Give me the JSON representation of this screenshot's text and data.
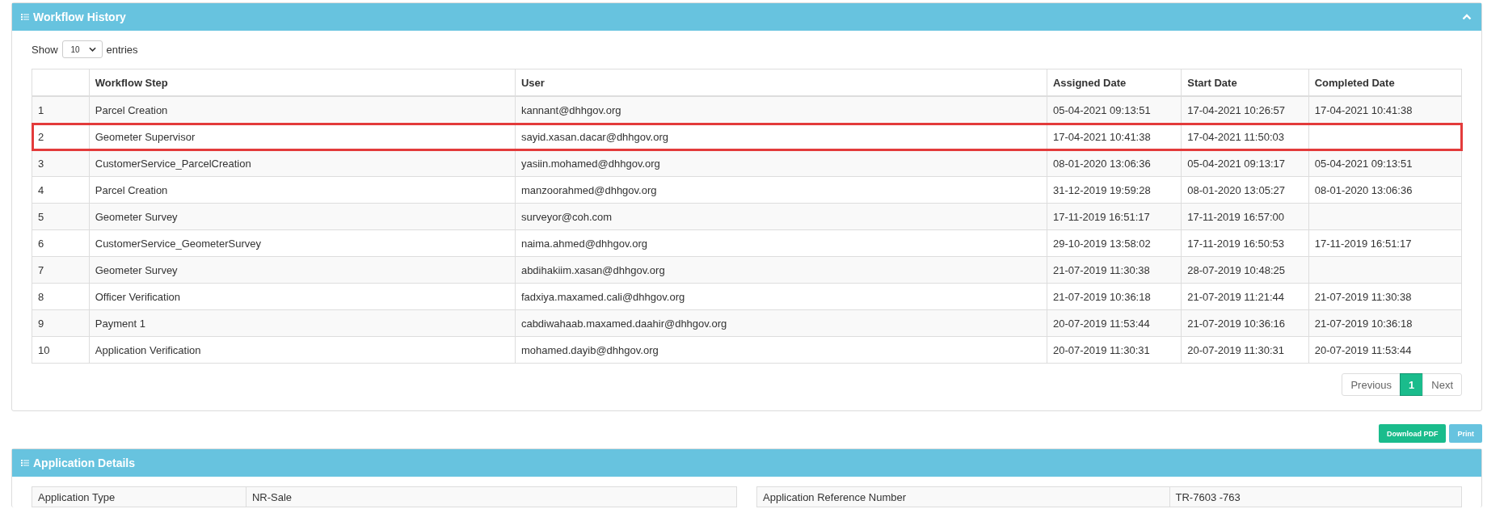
{
  "workflow_panel": {
    "title": "Workflow History",
    "show_label": "Show",
    "page_size": "10",
    "entries_label": "entries",
    "table": {
      "columns": [
        "",
        "Workflow Step",
        "User",
        "Assigned Date",
        "Start Date",
        "Completed Date"
      ],
      "rows": [
        {
          "cells": [
            "1",
            "Parcel Creation",
            "kannant@dhhgov.org",
            "05-04-2021 09:13:51",
            "17-04-2021 10:26:57",
            "17-04-2021 10:41:38"
          ],
          "highlighted": false
        },
        {
          "cells": [
            "2",
            "Geometer Supervisor",
            "sayid.xasan.dacar@dhhgov.org",
            "17-04-2021 10:41:38",
            "17-04-2021 11:50:03",
            ""
          ],
          "highlighted": true
        },
        {
          "cells": [
            "3",
            "CustomerService_ParcelCreation",
            "yasiin.mohamed@dhhgov.org",
            "08-01-2020 13:06:36",
            "05-04-2021 09:13:17",
            "05-04-2021 09:13:51"
          ],
          "highlighted": false
        },
        {
          "cells": [
            "4",
            "Parcel Creation",
            "manzoorahmed@dhhgov.org",
            "31-12-2019 19:59:28",
            "08-01-2020 13:05:27",
            "08-01-2020 13:06:36"
          ],
          "highlighted": false
        },
        {
          "cells": [
            "5",
            "Geometer Survey",
            "surveyor@coh.com",
            "17-11-2019 16:51:17",
            "17-11-2019 16:57:00",
            ""
          ],
          "highlighted": false
        },
        {
          "cells": [
            "6",
            "CustomerService_GeometerSurvey",
            "naima.ahmed@dhhgov.org",
            "29-10-2019 13:58:02",
            "17-11-2019 16:50:53",
            "17-11-2019 16:51:17"
          ],
          "highlighted": false
        },
        {
          "cells": [
            "7",
            "Geometer Survey",
            "abdihakiim.xasan@dhhgov.org",
            "21-07-2019 11:30:38",
            "28-07-2019 10:48:25",
            ""
          ],
          "highlighted": false
        },
        {
          "cells": [
            "8",
            "Officer Verification",
            "fadxiya.maxamed.cali@dhhgov.org",
            "21-07-2019 10:36:18",
            "21-07-2019 11:21:44",
            "21-07-2019 11:30:38"
          ],
          "highlighted": false
        },
        {
          "cells": [
            "9",
            "Payment 1",
            "cabdiwahaab.maxamed.daahir@dhhgov.org",
            "20-07-2019 11:53:44",
            "21-07-2019 10:36:16",
            "21-07-2019 10:36:18"
          ],
          "highlighted": false
        },
        {
          "cells": [
            "10",
            "Application Verification",
            "mohamed.dayib@dhhgov.org",
            "20-07-2019 11:30:31",
            "20-07-2019 11:30:31",
            "20-07-2019 11:53:44"
          ],
          "highlighted": false
        }
      ]
    },
    "pagination": [
      {
        "label": "Previous",
        "selected": false
      },
      {
        "label": "1",
        "selected": true
      },
      {
        "label": "Next",
        "selected": false
      }
    ]
  },
  "actions": [
    "Download PDF",
    "Print"
  ],
  "details_panel": {
    "title": "Application Details",
    "fields": [
      {
        "label": "Application Type",
        "value": "NR-Sale"
      },
      {
        "label": "Application Reference Number",
        "value": "TR-7603 -763"
      }
    ]
  }
}
